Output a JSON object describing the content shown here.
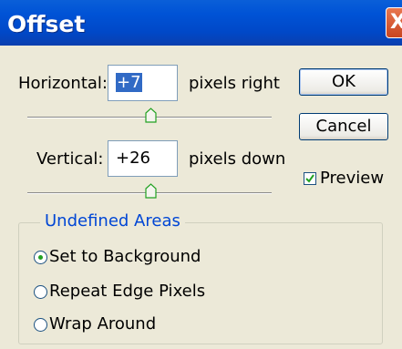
{
  "window": {
    "title": "Offset",
    "close_glyph": "X"
  },
  "horizontal": {
    "label": "Horizontal:",
    "value": "+7",
    "unit": "pixels right",
    "value_selected": true
  },
  "vertical": {
    "label": "Vertical:",
    "value": "+26",
    "unit": "pixels down"
  },
  "buttons": {
    "ok": "OK",
    "cancel": "Cancel"
  },
  "preview": {
    "label": "Preview",
    "checked": true
  },
  "undefined_areas": {
    "title": "Undefined Areas",
    "options": [
      {
        "label": "Set to Background",
        "selected": true
      },
      {
        "label": "Repeat Edge Pixels",
        "selected": false
      },
      {
        "label": "Wrap Around",
        "selected": false
      }
    ]
  },
  "colors": {
    "titlebar": "#0053d6",
    "dialog_bg": "#ece9d8",
    "group_title": "#0046d5",
    "selection": "#316ac5",
    "checkmark": "#21a121"
  },
  "icons": [
    "close-icon",
    "slider-thumb-icon",
    "checkmark-icon",
    "radio-dot-icon"
  ]
}
